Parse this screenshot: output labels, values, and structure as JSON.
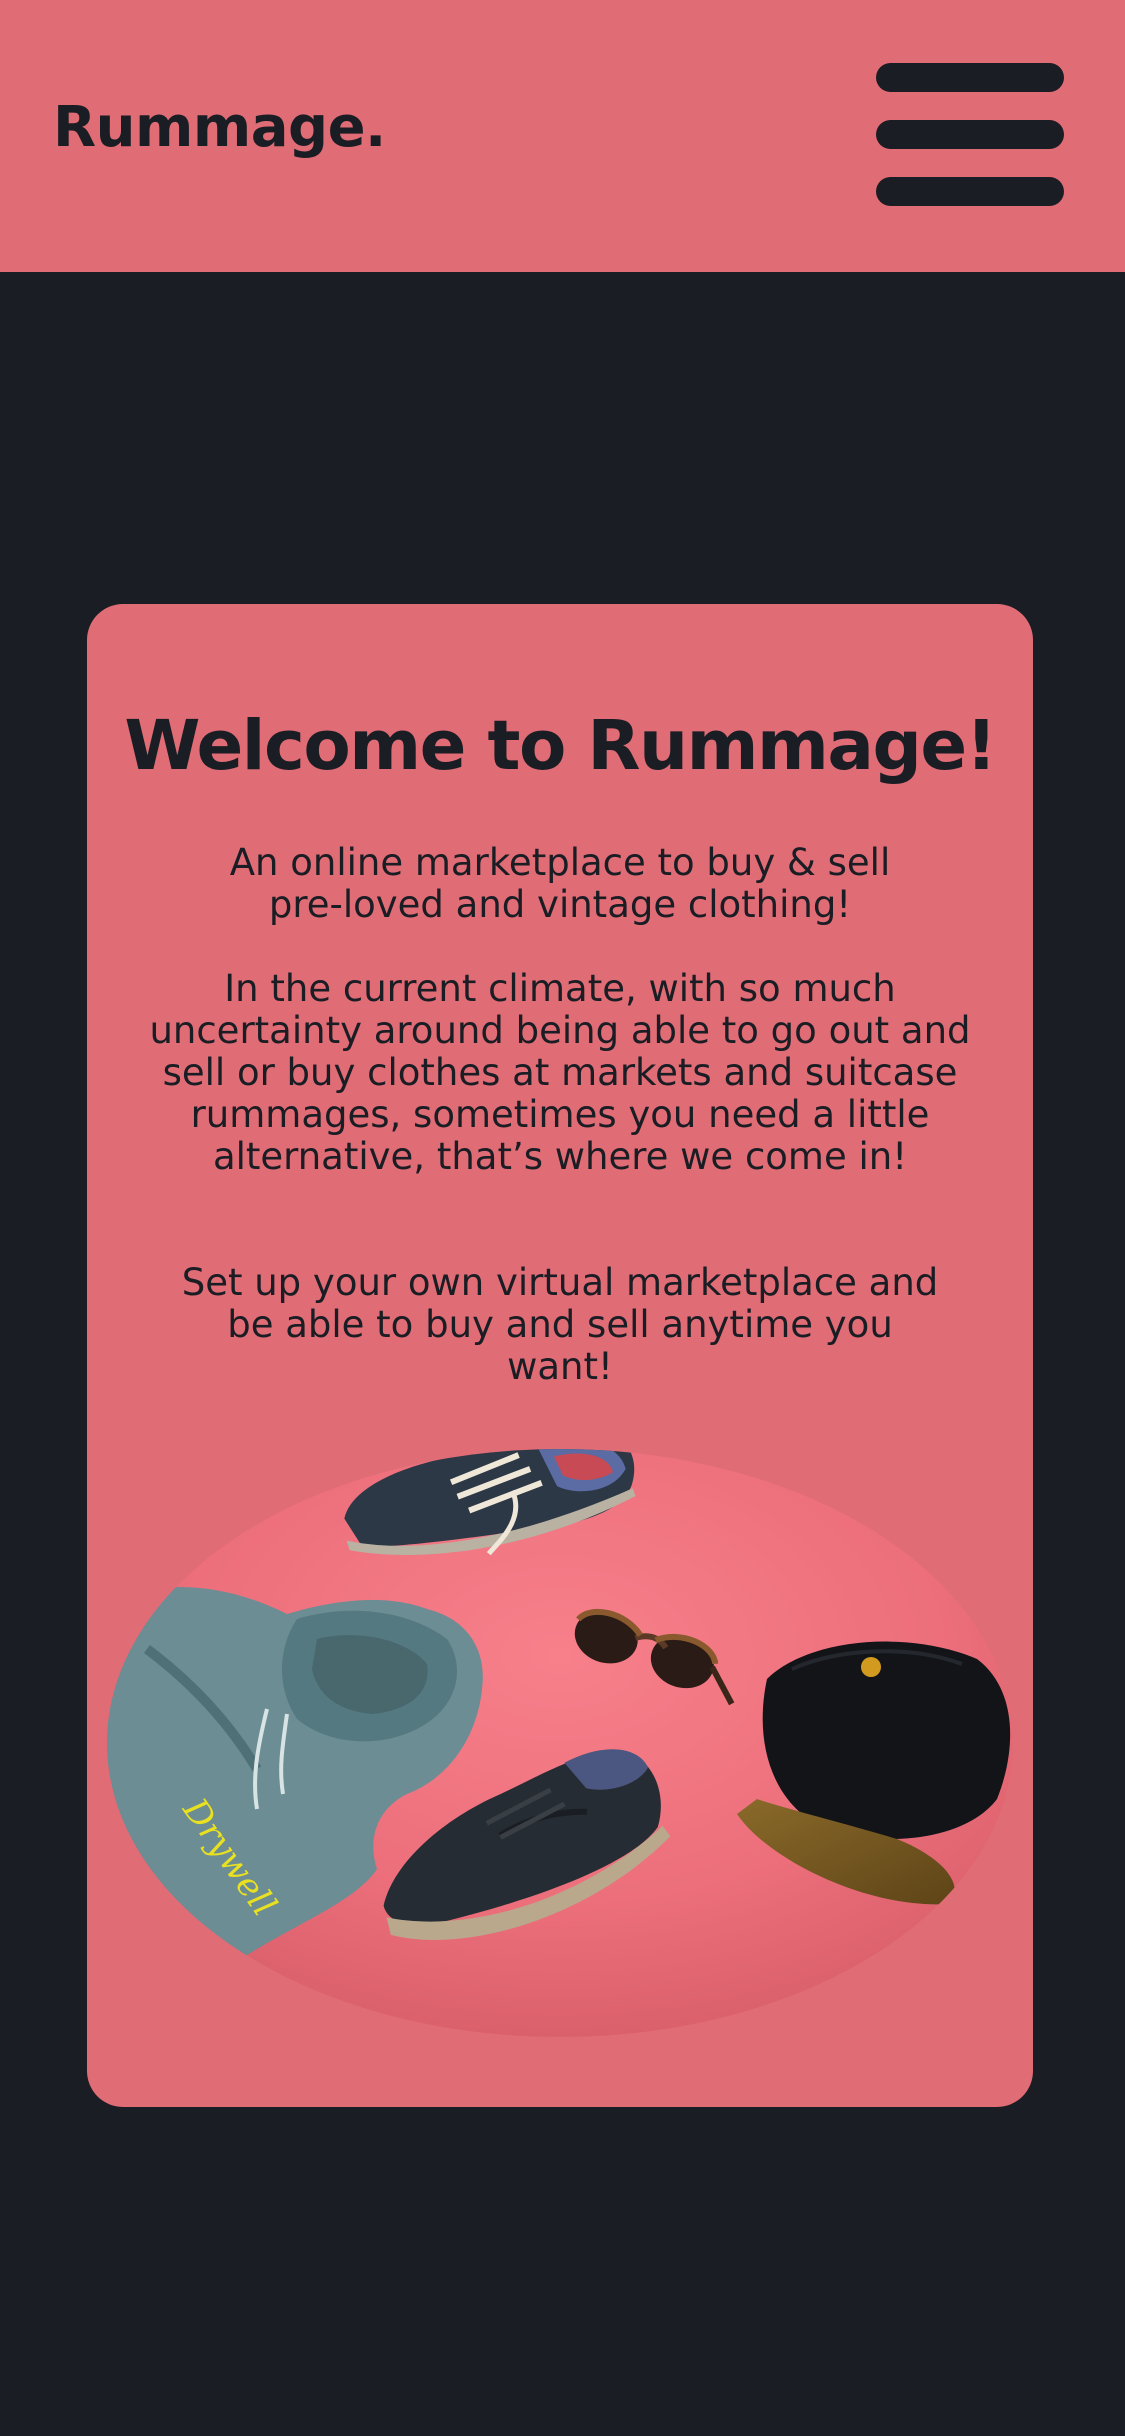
{
  "header": {
    "logo": "Rummage.",
    "menu_icon": "hamburger-menu-icon"
  },
  "welcome": {
    "title": "Welcome to Rummage!",
    "paragraphs": [
      "An online marketplace to buy & sell pre-loved and vintage clothing!",
      "In the current climate, with so much uncertainty around being able to go out and sell or buy clothes at markets and suitcase rummages, sometimes you need a little alternative, that’s where we come in!",
      "Set up your own virtual marketplace and be able to buy and sell anytime you want!"
    ]
  },
  "colors": {
    "accent": "#e06c75",
    "background": "#1b1d24",
    "text": "#1b1d24"
  }
}
